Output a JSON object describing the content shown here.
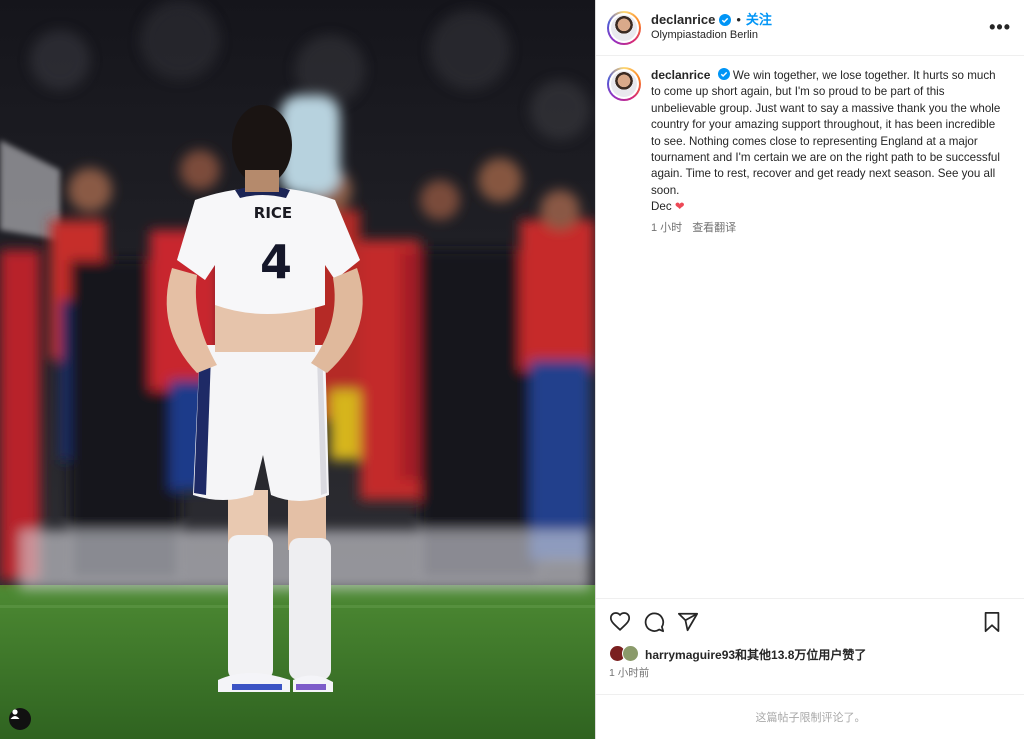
{
  "post": {
    "username": "declanrice",
    "follow_label": "关注",
    "location": "Olympiastadion Berlin",
    "more_label": "•••",
    "caption": "We win together, we lose together. It hurts so much to come up short again, but I'm so proud to be part of this unbelievable group. Just want to say a massive thank you the whole country for your amazing support throughout, it has been incredible to see. Nothing comes close to representing England at a major tournament and I'm certain we are on the right path to be successful again. Time to rest, recover and get ready next season. See you all soon.",
    "signoff": "Dec",
    "signoff_emoji": "❤",
    "caption_time": "1 小时",
    "translate_label": "查看翻译",
    "likes_user": "harrymaguire93",
    "likes_rest": "和其他13.8万位用户赞了",
    "timestamp": "1 小时前",
    "comments_disabled": "这篇帖子限制评论了。"
  },
  "photo": {
    "jersey_name": "RICE",
    "jersey_number": "4"
  },
  "icons": {
    "like": "heart-icon",
    "comment": "comment-icon",
    "share": "share-icon",
    "save": "bookmark-icon",
    "verified": "verified-badge-icon",
    "tag": "user-tag-icon"
  },
  "colors": {
    "link": "#0095f6",
    "verified": "#0095f6",
    "heart": "#ed4956",
    "pitch": "#3e7a2a"
  }
}
